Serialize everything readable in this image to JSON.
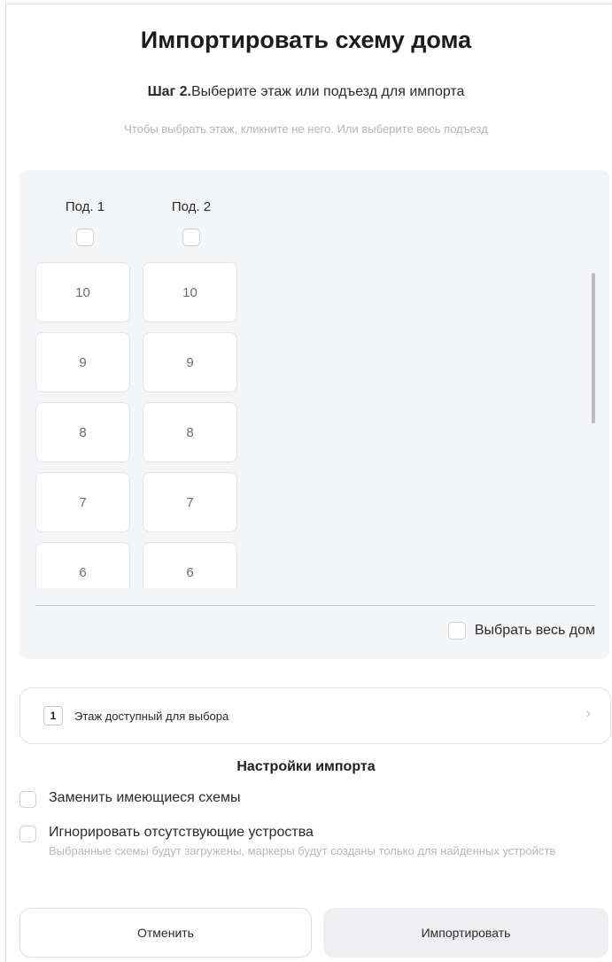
{
  "dialog": {
    "title": "Импортировать схему дома",
    "step_prefix": "Шаг 2.",
    "step_text": "Выберите этаж или подъезд для импорта",
    "hint": "Чтобы выбрать этаж, кликните не него. Или выберите весь подъезд"
  },
  "entrances": [
    {
      "label": "Под. 1",
      "checked": false,
      "floors": [
        "10",
        "9",
        "8",
        "7",
        "6"
      ]
    },
    {
      "label": "Под. 2",
      "checked": false,
      "floors": [
        "10",
        "9",
        "8",
        "7",
        "6"
      ]
    }
  ],
  "select_whole_house": {
    "label": "Выбрать весь дом",
    "checked": false
  },
  "available": {
    "count": "1",
    "label": "Этаж доступный для выбора",
    "chevron_icon": "chevron-right-icon"
  },
  "settings": {
    "title": "Настройки импорта",
    "replace_existing": {
      "label": "Заменить имеющиеся схемы",
      "checked": false
    },
    "ignore_missing": {
      "label": "Игнорировать отсутствующие устроства",
      "description": "Выбранные схемы будут загружены, маркеры будут созданы только для найденных устройств",
      "checked": false
    }
  },
  "buttons": {
    "cancel": "Отменить",
    "import": "Импортировать"
  }
}
